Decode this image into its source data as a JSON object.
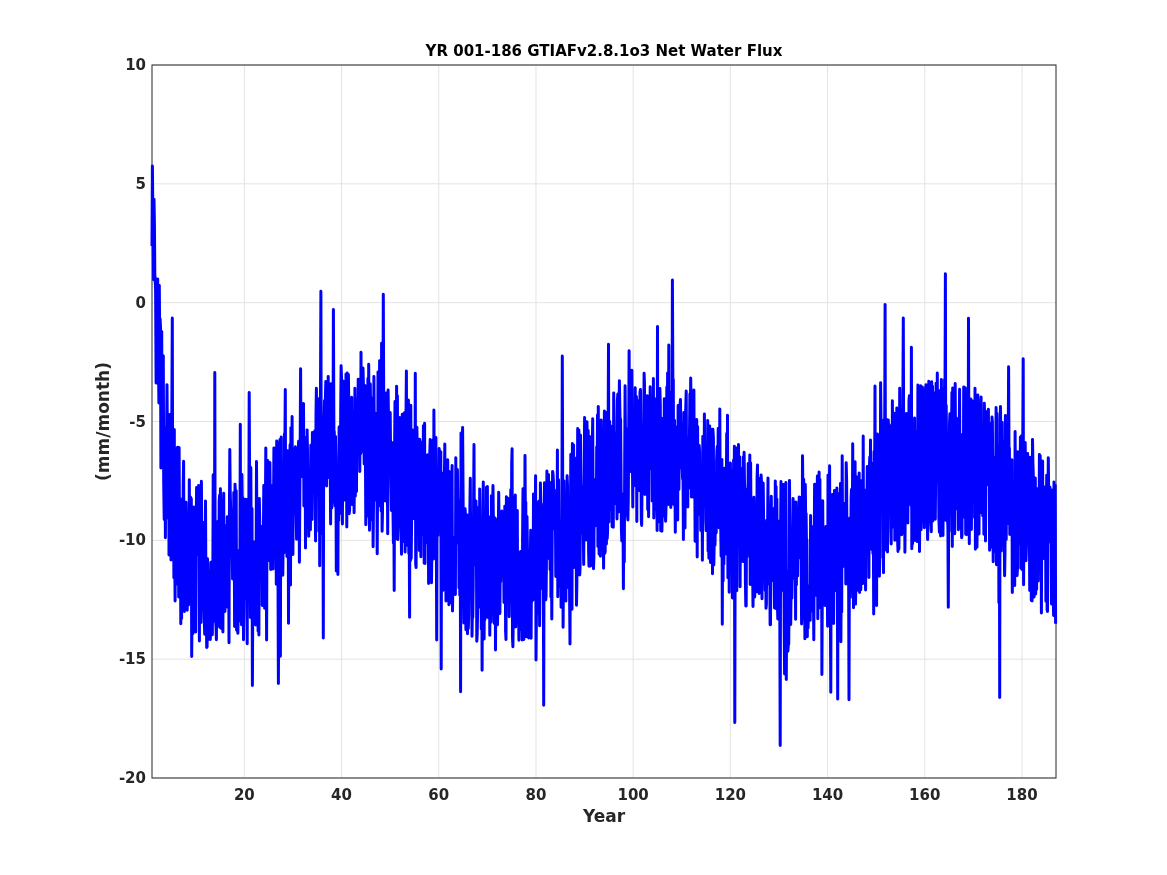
{
  "figure": {
    "title": "YR 001-186 GTIAFv2.8.1o3 Net Water Flux",
    "xlabel": "Year",
    "ylabel": "(mm/month)",
    "xticks": [
      "20",
      "40",
      "60",
      "80",
      "100",
      "120",
      "140",
      "160",
      "180"
    ],
    "yticks": [
      "10",
      "5",
      "0",
      "-5",
      "-10",
      "-15",
      "-20"
    ]
  }
}
